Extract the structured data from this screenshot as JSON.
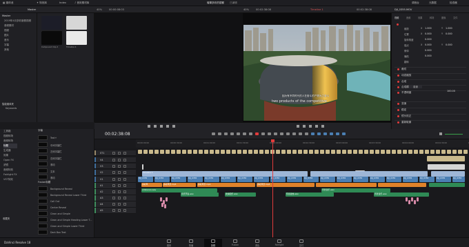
{
  "app": {
    "name": "DaVinci Resolve 18"
  },
  "topbar": {
    "media_pool": "媒体池",
    "effects": "特效库",
    "index": "Index",
    "sound_library": "音效素材库",
    "project_title": "璀璨多彩的银都",
    "edit_state": "已编辑",
    "mixer": "调音台",
    "metadata": "元数据",
    "inspector": "检查器"
  },
  "bar2": {
    "bin_label": "Master",
    "zoom_left": "40%",
    "timecode_left": "00:00:08:03",
    "zoom_right": "40%",
    "timecode_right": "00:02:38:08",
    "timeline_name": "Timeline 1",
    "clip_name": "DJI_0355.MOV"
  },
  "media_pool": {
    "tree_header": "Master",
    "tree_items": [
      "2019年4月多彩度假视频",
      "音频素材",
      "视频",
      "图片",
      "音乐",
      "字幕",
      "其他"
    ],
    "smart_bins": "智能媒体夹",
    "keywords": "Keywords",
    "clips": [
      {
        "name": "Timeline 1",
        "color": "#1c1d28"
      },
      {
        "name": "Compound Clip 1",
        "color": "#d7d7d7"
      },
      {
        "name": "Compound Clip 2",
        "color": "#0a0a0a"
      },
      {
        "name": "Timeline 1",
        "color": "#e9e9e9"
      }
    ]
  },
  "viewer": {
    "subtitle_cn": "因为有不同时代的人在奋斗的产物为之奋斗",
    "subtitle_en": "two products of the competitive"
  },
  "inspector": {
    "tabs": [
      "视频",
      "音频",
      "效果",
      "转场",
      "图像",
      "文件"
    ],
    "rows": [
      {
        "label": "缩放",
        "x": "X",
        "xv": "1.000",
        "y": "Y",
        "yv": "1.000"
      },
      {
        "label": "位置",
        "x": "X",
        "xv": "0.000",
        "y": "Y",
        "yv": "0.000"
      },
      {
        "label": "旋转角度",
        "x": "",
        "xv": "0.000",
        "y": "",
        "yv": ""
      },
      {
        "label": "锚点",
        "x": "X",
        "xv": "0.000",
        "y": "Y",
        "yv": "0.000"
      },
      {
        "label": "俯仰",
        "x": "",
        "xv": "0.000",
        "y": "",
        "yv": ""
      },
      {
        "label": "偏航",
        "x": "",
        "xv": "0.000",
        "y": "",
        "yv": ""
      },
      {
        "label": "翻转",
        "x": "",
        "xv": "",
        "y": "",
        "yv": ""
      }
    ],
    "sections": [
      "裁切",
      "动态缩放",
      "合成",
      "合成模式",
      "不透明度",
      "变速",
      "稳定",
      "镜头校正",
      "重新取景"
    ],
    "composite_mode": "普通",
    "opacity": "100.00"
  },
  "effects": {
    "tree": [
      "工具箱",
      "视频转场",
      "音频转场",
      "标题",
      "生成器",
      "效果",
      "Open FX",
      "滤镜",
      "音频特效",
      "Fairlight FX",
      "VST特效"
    ],
    "titles_header": "字幕",
    "title_items": [
      "Text+",
      "中间字幕栏",
      "左侧字幕栏",
      "右侧字幕栏",
      "滚动",
      "文本",
      "滚动"
    ],
    "fusion_header": "Fusion标题",
    "fusion_items": [
      "Background Reveal",
      "Background Reveal Lower Third",
      "Call Out",
      "Center Reveal",
      "Clean and Simple",
      "Clean and Simple Heading Lower T...",
      "Clean and Simple Lower Third",
      "Dark Box Text"
    ],
    "favorites": "收藏夹"
  },
  "timeline": {
    "timecode": "00:02:38:08",
    "ruler": [
      "00:00:00:00",
      "00:00:30:00",
      "00:01:00:00",
      "00:01:30:00",
      "00:02:00:00",
      "00:02:30:00",
      "00:03:00:00",
      "00:03:30:00",
      "00:04:00:00",
      "00:04:30:00",
      "00:05:00:00"
    ],
    "tracks": [
      {
        "id": "ST1",
        "color": "#9a8a6a"
      },
      {
        "id": "V4",
        "color": "#3f6f9f"
      },
      {
        "id": "V3",
        "color": "#3f6f9f"
      },
      {
        "id": "V2",
        "color": "#3f6f9f"
      },
      {
        "id": "V1",
        "color": "#3f6f9f"
      },
      {
        "id": "A1",
        "color": "#3f8f5f"
      },
      {
        "id": "A2",
        "color": "#3f8f5f"
      },
      {
        "id": "A3",
        "color": "#3f8f5f"
      },
      {
        "id": "A4",
        "color": "#3f8f5f"
      },
      {
        "id": "A5",
        "color": "#3f8f5f"
      }
    ],
    "clip_labels": {
      "orange1": "多彩风",
      "orange2": "多彩风景.mp4",
      "orange3": "多彩风景.mp4",
      "orange4": "多彩风景.mp4",
      "green1": "ambiance.wav",
      "green2": "音乐节奏.wav",
      "green3": "欢快配乐.wav",
      "green4": "环境音效.wav",
      "green5": "背景音乐.wav",
      "green6": "背景音乐.wav",
      "v2_label": "Timeline 1",
      "v1_label": "DJI_0355"
    },
    "playhead_percent": 41
  },
  "pages": [
    {
      "label": "媒体",
      "active": false
    },
    {
      "label": "快编",
      "active": false
    },
    {
      "label": "剪辑",
      "active": true
    },
    {
      "label": "Fusion",
      "active": false
    },
    {
      "label": "调色",
      "active": false
    },
    {
      "label": "Fairlight",
      "active": false
    },
    {
      "label": "交付",
      "active": false
    }
  ],
  "colors": {
    "accent": "#e23b3b",
    "clip_orange": "#e0822a",
    "clip_green": "#2f8a55",
    "clip_blue": "#4b7fb3",
    "clip_tan": "#c9b98c",
    "clip_pink": "#d78aa8"
  }
}
